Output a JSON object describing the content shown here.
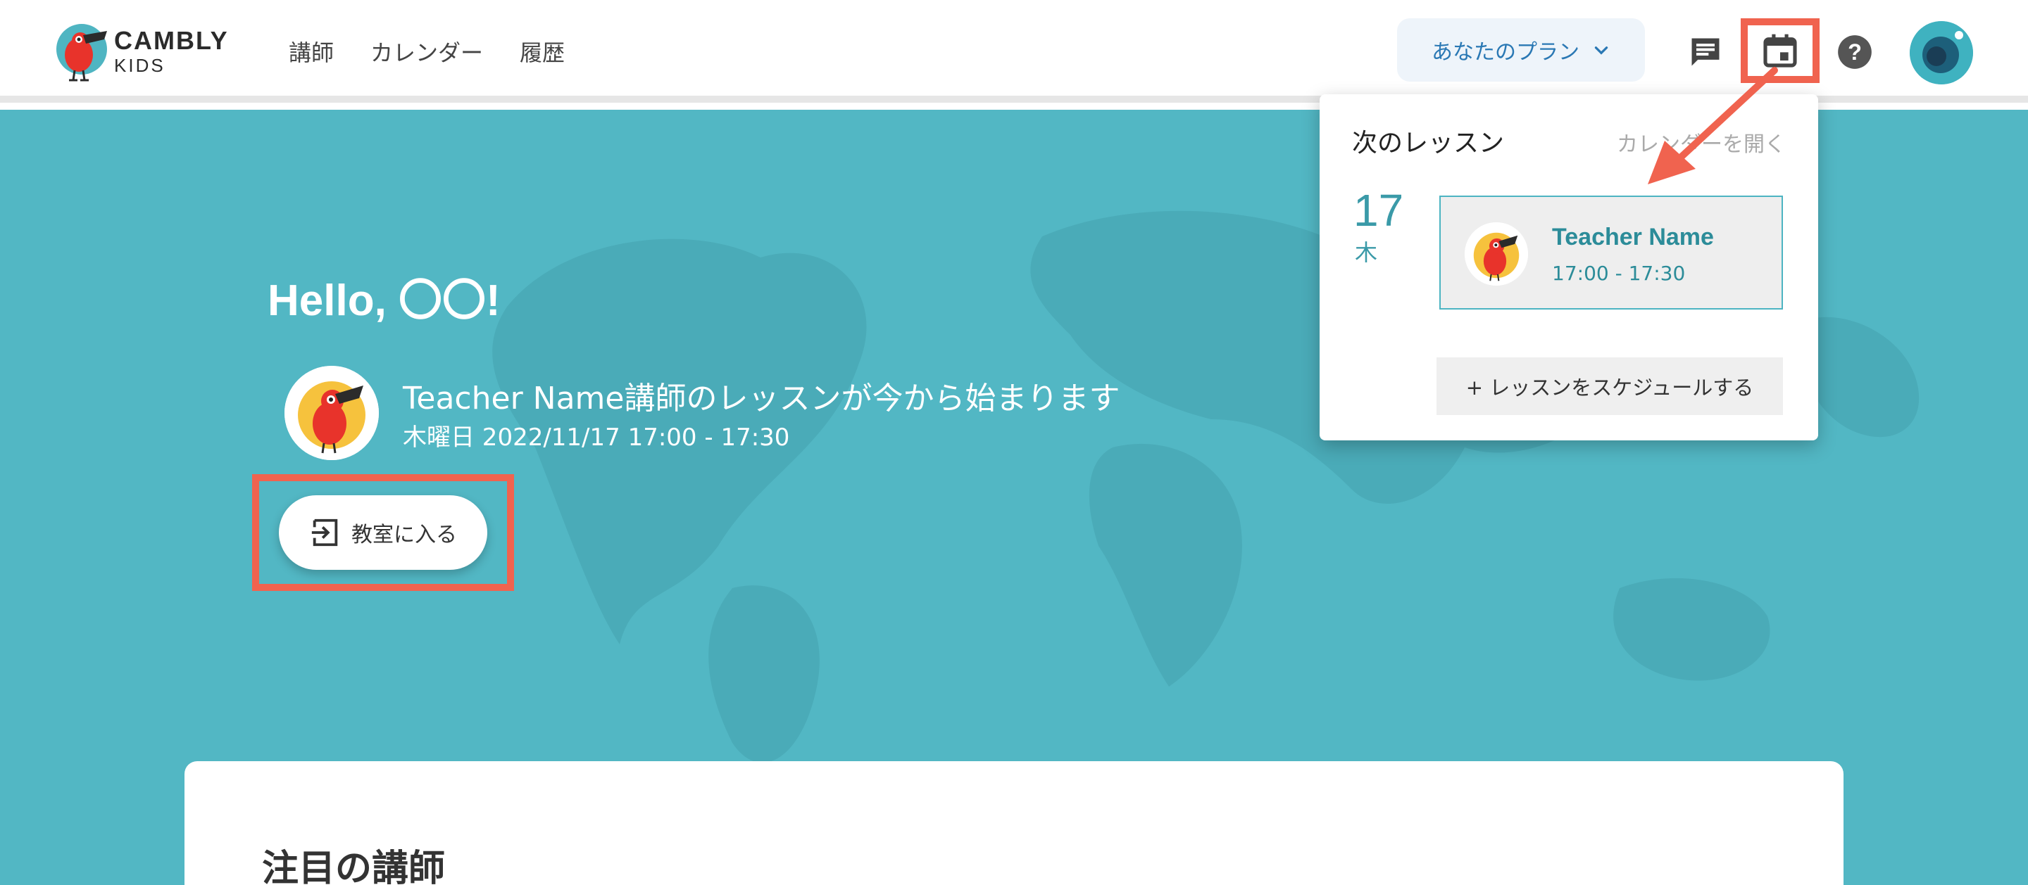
{
  "header": {
    "logo": {
      "line1": "CAMBLY",
      "line2": "KIDS"
    },
    "nav": [
      "講師",
      "カレンダー",
      "履歴"
    ],
    "plan_label": "あなたのプラン",
    "icons": [
      "message-icon",
      "calendar-icon",
      "help-icon",
      "avatar"
    ]
  },
  "hero": {
    "greeting": "Hello, 〇〇!",
    "lesson_title": "Teacher Name講師のレッスンが今から始まります",
    "lesson_time": "木曜日 2022/11/17 17:00 - 17:30",
    "enter_label": "教室に入る"
  },
  "featured": {
    "title": "注目の講師"
  },
  "popup": {
    "heading": "次のレッスン",
    "open_calendar": "カレンダーを開く",
    "day_number": "17",
    "day_name": "木",
    "teacher_name": "Teacher Name",
    "lesson_time": "17:00 - 17:30",
    "schedule_label": "+ レッスンをスケジュールする"
  },
  "colors": {
    "accent": "#52b7c4",
    "highlight": "#f0634f",
    "teal_text": "#2c8c99",
    "plan_text": "#2a78b4"
  }
}
